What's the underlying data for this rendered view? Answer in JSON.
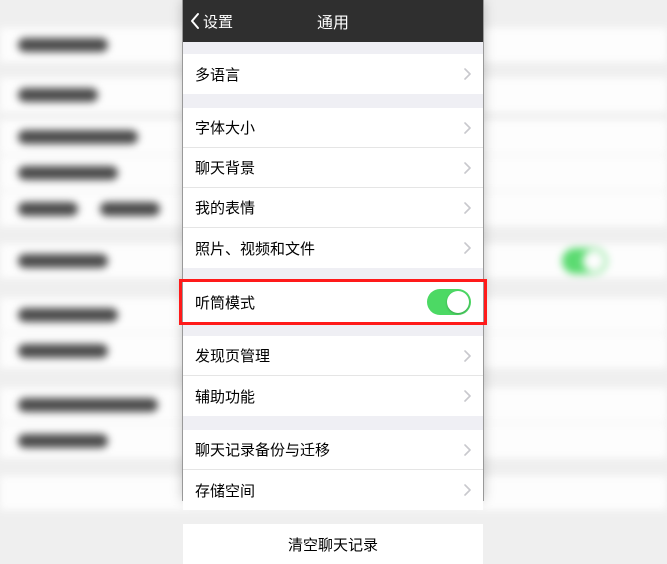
{
  "nav": {
    "back_label": "设置",
    "title": "通用"
  },
  "groups": [
    {
      "cells": [
        {
          "label": "多语言",
          "type": "disclosure"
        }
      ]
    },
    {
      "cells": [
        {
          "label": "字体大小",
          "type": "disclosure"
        },
        {
          "label": "聊天背景",
          "type": "disclosure"
        },
        {
          "label": "我的表情",
          "type": "disclosure"
        },
        {
          "label": "照片、视频和文件",
          "type": "disclosure"
        }
      ]
    },
    {
      "cells": [
        {
          "label": "听筒模式",
          "type": "toggle",
          "on": true,
          "highlighted": true
        }
      ]
    },
    {
      "cells": [
        {
          "label": "发现页管理",
          "type": "disclosure"
        },
        {
          "label": "辅助功能",
          "type": "disclosure"
        }
      ]
    },
    {
      "cells": [
        {
          "label": "聊天记录备份与迁移",
          "type": "disclosure"
        },
        {
          "label": "存储空间",
          "type": "disclosure"
        }
      ]
    }
  ],
  "clear_label": "清空聊天记录"
}
